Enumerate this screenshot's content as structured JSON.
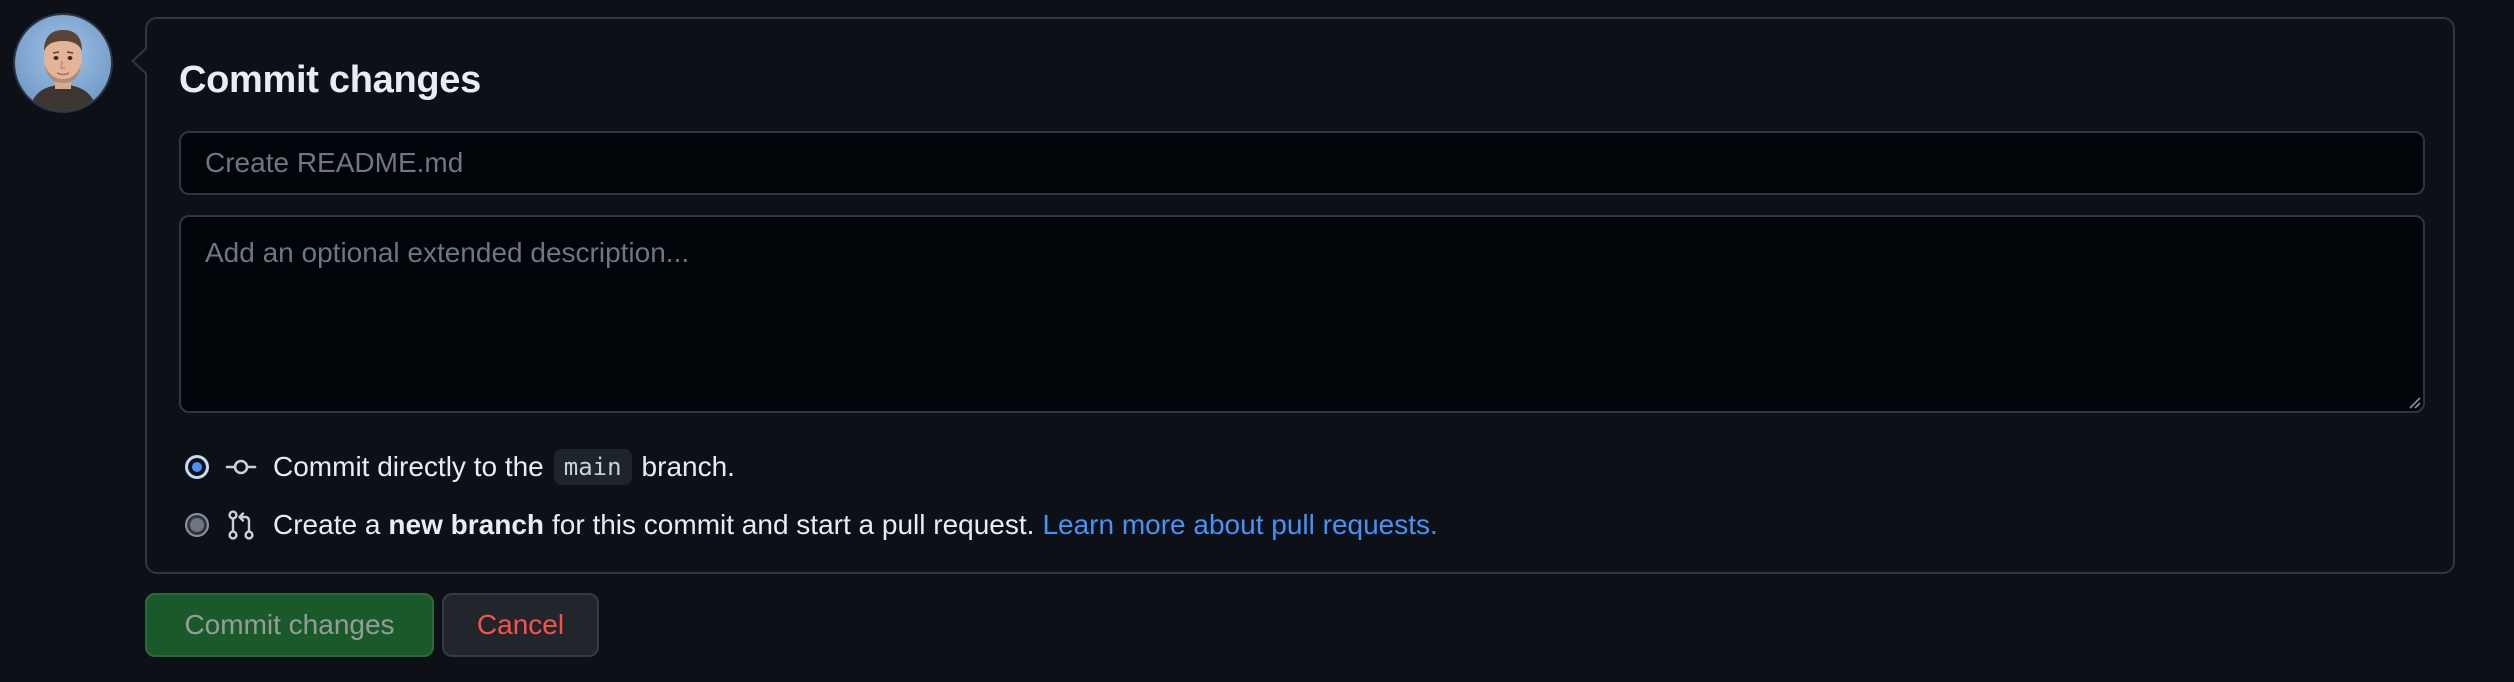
{
  "user": {
    "avatar_alt": "User avatar"
  },
  "commit_panel": {
    "title": "Commit changes",
    "summary_placeholder": "Create README.md",
    "summary_value": "",
    "description_placeholder": "Add an optional extended description...",
    "description_value": "",
    "options": [
      {
        "checked": true,
        "icon": "git-commit-icon",
        "text_before": "Commit directly to the",
        "branch_name": "main",
        "text_after": "branch."
      },
      {
        "checked": false,
        "icon": "git-pull-request-icon",
        "text_before": "Create a",
        "bold_text": "new branch",
        "text_after": "for this commit and start a pull request.",
        "link_text": "Learn more about pull requests."
      }
    ]
  },
  "actions": {
    "commit_label": "Commit changes",
    "cancel_label": "Cancel"
  },
  "colors": {
    "background": "#0d1117",
    "border": "#30363d",
    "accent_link": "#4493f8",
    "commit_green": "#238636",
    "cancel_red": "#f85149"
  }
}
